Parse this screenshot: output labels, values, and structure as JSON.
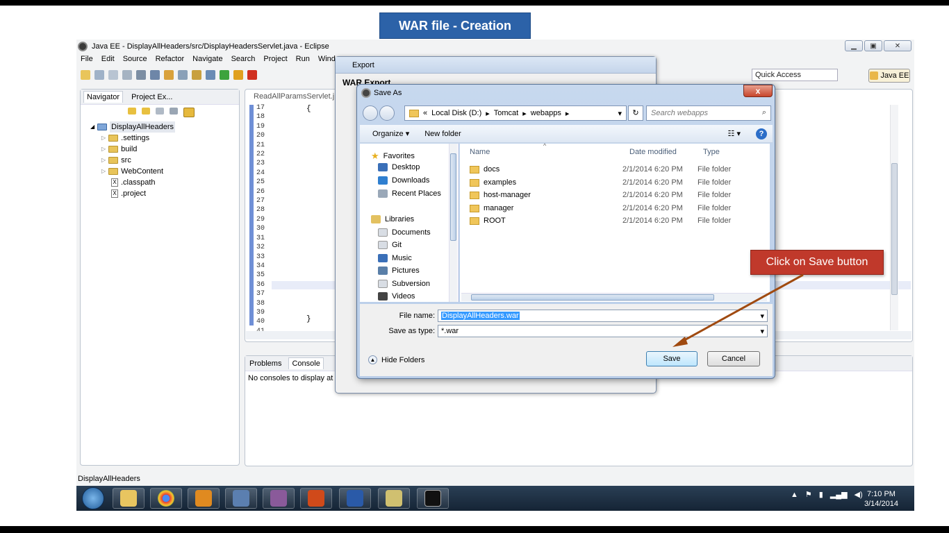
{
  "slide": {
    "title": "WAR  file - Creation",
    "callout": "Click on  Save button"
  },
  "eclipse": {
    "title": "Java EE - DisplayAllHeaders/src/DisplayHeadersServlet.java - Eclipse",
    "menu": [
      "File",
      "Edit",
      "Source",
      "Refactor",
      "Navigate",
      "Search",
      "Project",
      "Run",
      "Window"
    ],
    "quick_access": "Quick Access",
    "perspective": "Java EE",
    "navigator": {
      "tabs": [
        "Navigator",
        "Project Ex..."
      ],
      "project": "DisplayAllHeaders",
      "items": [
        ".settings",
        "build",
        "src",
        "WebContent",
        ".classpath",
        ".project"
      ]
    },
    "editor": {
      "tab": "ReadAllParamsServlet.j",
      "line_numbers": [
        "17",
        "18",
        "19",
        "20",
        "21",
        "22",
        "23",
        "24",
        "25",
        "26",
        "27",
        "28",
        "29",
        "30",
        "31",
        "32",
        "33",
        "34",
        "35",
        "36",
        "37",
        "38",
        "39",
        "40",
        "41"
      ],
      "brace_open": "{",
      "brace_close": "}"
    },
    "console": {
      "tabs": [
        "Problems",
        "Console"
      ],
      "message": "No consoles to display at t"
    },
    "status": "DisplayAllHeaders"
  },
  "export_dialog": {
    "title": "Export",
    "heading": "WAR Export"
  },
  "save_as": {
    "title": "Save As",
    "close": "x",
    "path": [
      "«",
      "Local Disk (D:)",
      "Tomcat",
      "webapps"
    ],
    "search_placeholder": "Search webapps",
    "organize": "Organize ▾",
    "new_folder": "New folder",
    "nav": {
      "favorites_label": "Favorites",
      "favorites": [
        "Desktop",
        "Downloads",
        "Recent Places"
      ],
      "libraries_label": "Libraries",
      "libraries": [
        "Documents",
        "Git",
        "Music",
        "Pictures",
        "Subversion",
        "Videos"
      ]
    },
    "columns": {
      "name": "Name",
      "date": "Date modified",
      "type": "Type"
    },
    "files": [
      {
        "name": "docs",
        "date": "2/1/2014 6:20 PM",
        "type": "File folder"
      },
      {
        "name": "examples",
        "date": "2/1/2014 6:20 PM",
        "type": "File folder"
      },
      {
        "name": "host-manager",
        "date": "2/1/2014 6:20 PM",
        "type": "File folder"
      },
      {
        "name": "manager",
        "date": "2/1/2014 6:20 PM",
        "type": "File folder"
      },
      {
        "name": "ROOT",
        "date": "2/1/2014 6:20 PM",
        "type": "File folder"
      }
    ],
    "file_name_label": "File name:",
    "file_name": "DisplayAllHeaders.war",
    "save_type_label": "Save as type:",
    "save_type": "*.war",
    "hide_folders": "Hide Folders",
    "save": "Save",
    "cancel": "Cancel"
  },
  "taskbar": {
    "time": "7:10 PM",
    "date": "3/14/2014"
  }
}
